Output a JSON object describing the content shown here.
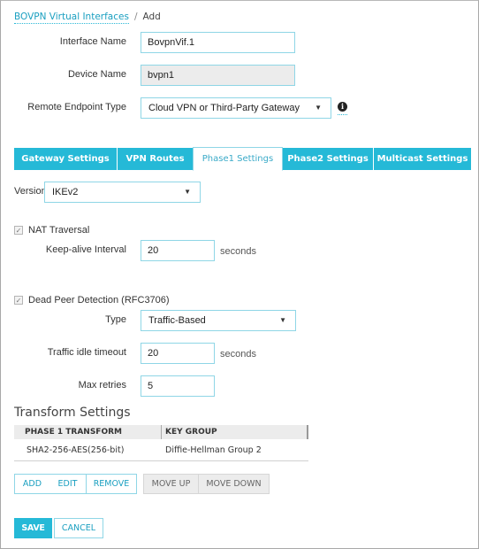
{
  "breadcrumb": {
    "parent": "BOVPN Virtual Interfaces",
    "separator": "/",
    "current": "Add"
  },
  "form": {
    "interface_name": {
      "label": "Interface Name",
      "value": "BovpnVif.1"
    },
    "device_name": {
      "label": "Device Name",
      "value": "bvpn1"
    },
    "remote_endpoint_type": {
      "label": "Remote Endpoint Type",
      "value": "Cloud VPN or Third-Party Gateway",
      "info_icon": "info-icon"
    }
  },
  "tabs": [
    {
      "label": "Gateway Settings",
      "active": false
    },
    {
      "label": "VPN Routes",
      "active": false
    },
    {
      "label": "Phase1 Settings",
      "active": true
    },
    {
      "label": "Phase2 Settings",
      "active": false
    },
    {
      "label": "Multicast Settings",
      "active": false
    }
  ],
  "phase1": {
    "version": {
      "label": "Version",
      "value": "IKEv2"
    },
    "nat_traversal": {
      "label": "NAT Traversal",
      "checked": true,
      "keepalive": {
        "label": "Keep-alive Interval",
        "value": "20",
        "unit": "seconds"
      }
    },
    "dpd": {
      "label": "Dead Peer Detection (RFC3706)",
      "checked": true,
      "type": {
        "label": "Type",
        "value": "Traffic-Based"
      },
      "idle_timeout": {
        "label": "Traffic idle timeout",
        "value": "20",
        "unit": "seconds"
      },
      "max_retries": {
        "label": "Max retries",
        "value": "5"
      }
    }
  },
  "transform": {
    "title": "Transform Settings",
    "columns": [
      "PHASE 1 TRANSFORM",
      "KEY GROUP"
    ],
    "rows": [
      [
        "SHA2-256-AES(256-bit)",
        "Diffie-Hellman Group 2"
      ]
    ],
    "buttons": {
      "add": "ADD",
      "edit": "EDIT",
      "remove": "REMOVE",
      "move_up": "MOVE UP",
      "move_down": "MOVE DOWN"
    }
  },
  "actions": {
    "save": "SAVE",
    "cancel": "CANCEL"
  },
  "icons": {
    "check": "✓",
    "arrow": "▼",
    "info": "i"
  },
  "colors": {
    "accent": "#25b9d7",
    "link": "#1a9fc0",
    "input_border": "#8fd6e6"
  }
}
